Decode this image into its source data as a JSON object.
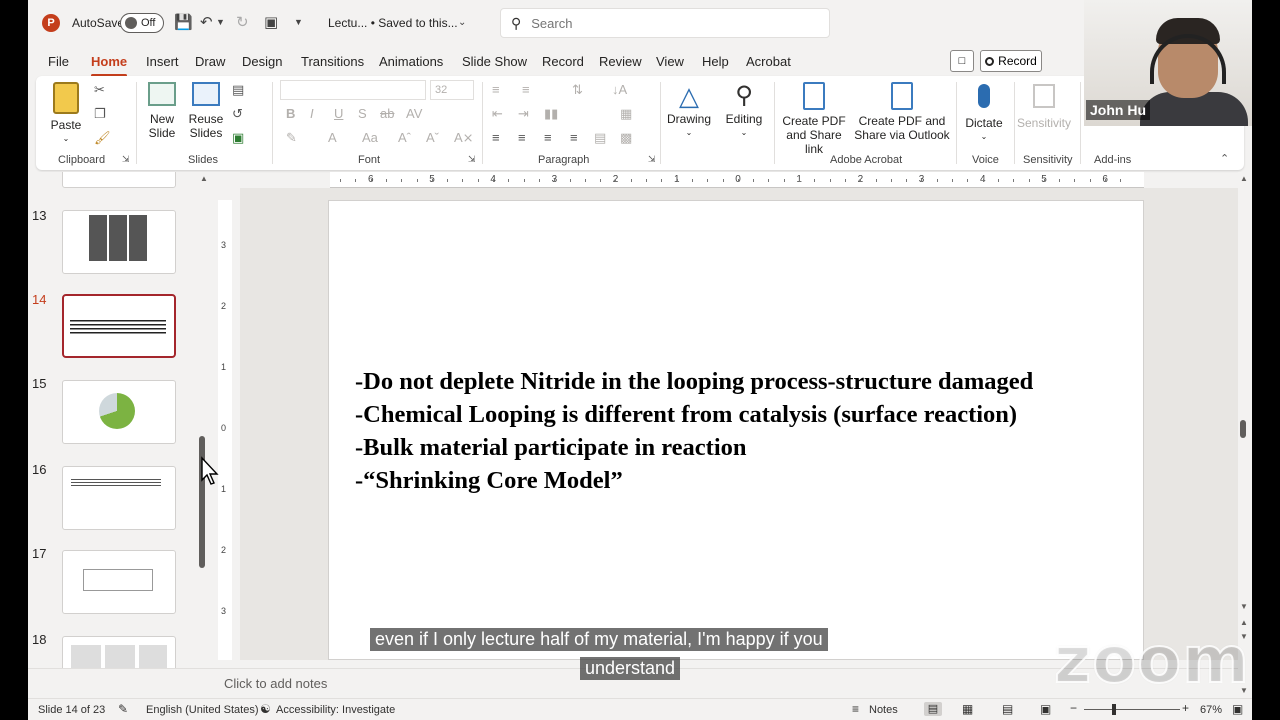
{
  "titlebar": {
    "autosave_label": "AutoSave",
    "autosave_state": "Off",
    "doc_name": "Lectu... • Saved to this...",
    "search_placeholder": "Search"
  },
  "menu": {
    "tabs": [
      "File",
      "Home",
      "Insert",
      "Draw",
      "Design",
      "Transitions",
      "Animations",
      "Slide Show",
      "Record",
      "Review",
      "View",
      "Help",
      "Acrobat"
    ],
    "active": "Home",
    "record_label": "Record"
  },
  "ribbon": {
    "paste": "Paste",
    "new_slide": "New Slide",
    "reuse_slides": "Reuse Slides",
    "font_size": "32",
    "drawing": "Drawing",
    "editing": "Editing",
    "create_pdf_share_link": "Create PDF and Share link",
    "create_pdf_outlook": "Create PDF and Share via Outlook",
    "dictate": "Dictate",
    "sensitivity": "Sensitivity",
    "groups": {
      "clipboard": "Clipboard",
      "slides": "Slides",
      "font": "Font",
      "paragraph": "Paragraph",
      "adobe_acrobat": "Adobe Acrobat",
      "voice": "Voice",
      "sensitivity": "Sensitivity",
      "addins": "Add-ins"
    }
  },
  "participant": {
    "name": "John Hu"
  },
  "thumbnails": {
    "numbers": [
      "13",
      "14",
      "15",
      "16",
      "17",
      "18"
    ],
    "active": "14"
  },
  "ruler": {
    "h_labels": [
      "6",
      "5",
      "4",
      "3",
      "2",
      "1",
      "0",
      "1",
      "2",
      "3",
      "4",
      "5",
      "6"
    ],
    "v_labels": [
      "3",
      "2",
      "1",
      "0",
      "1",
      "2",
      "3"
    ]
  },
  "slide": {
    "lines": [
      "-Do not deplete Nitride in the looping process-structure damaged",
      "-Chemical Looping is different from catalysis (surface reaction)",
      "-Bulk material participate in reaction",
      "-“Shrinking Core Model”"
    ]
  },
  "notes_placeholder": "Click to add notes",
  "status": {
    "slide_of": "Slide 14 of 23",
    "language": "English (United States)",
    "accessibility": "Accessibility: Investigate",
    "notes": "Notes",
    "zoom": "67%"
  },
  "captions": {
    "line1": "even if I only lecture half of my material, I'm happy if you",
    "line2": "understand"
  },
  "watermark": "zoom",
  "colors": {
    "accent": "#c43e1c",
    "selected_thumb": "#a4262c"
  }
}
